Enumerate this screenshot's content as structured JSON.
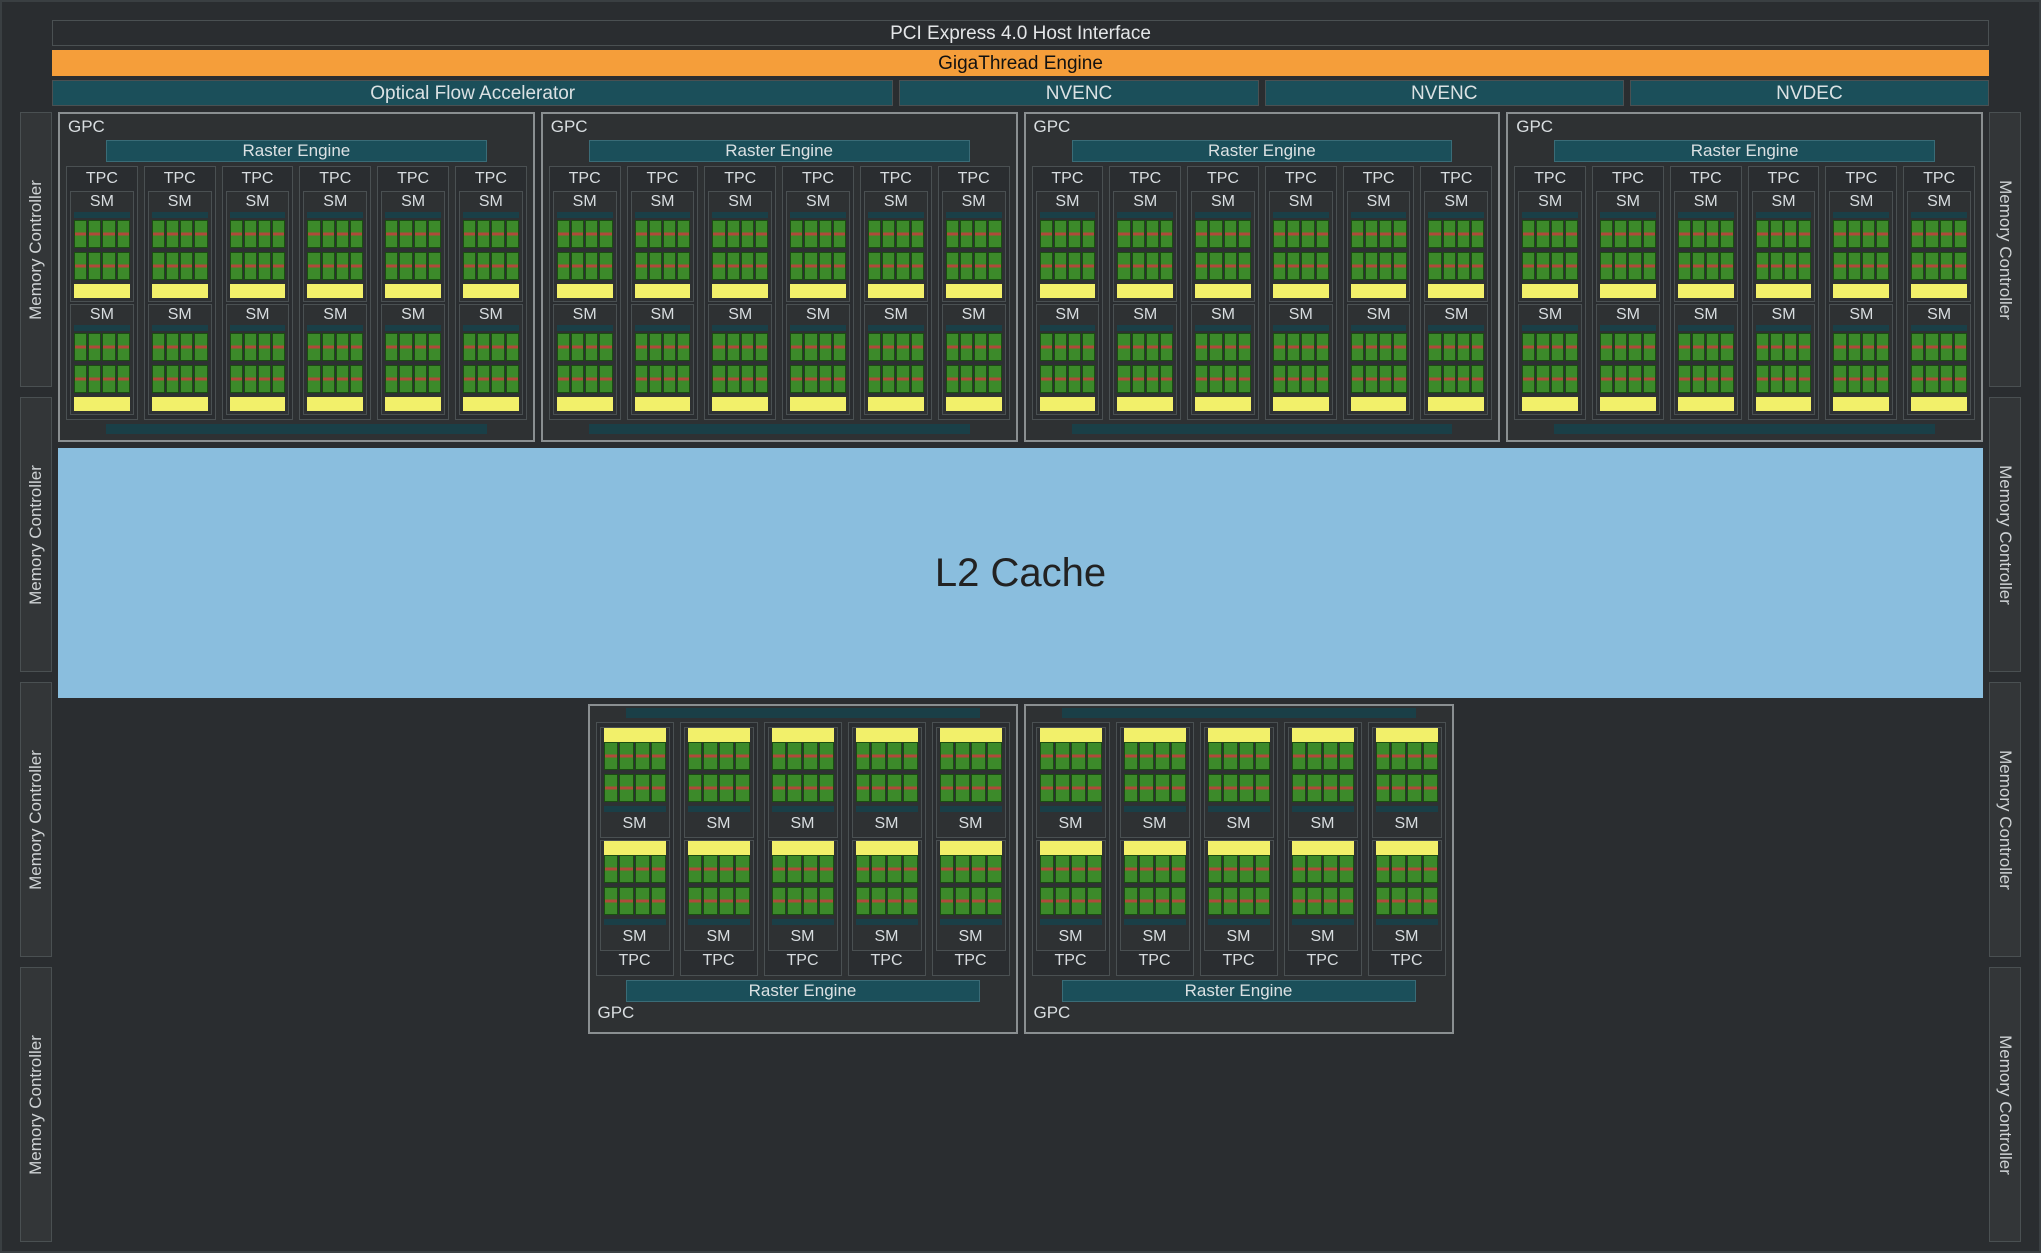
{
  "top": {
    "pci": "PCI Express 4.0 Host Interface",
    "giga": "GigaThread Engine",
    "ofa": "Optical Flow Accelerator",
    "nvenc": "NVENC",
    "nvdec": "NVDEC"
  },
  "labels": {
    "memctl": "Memory Controller",
    "gpc": "GPC",
    "raster": "Raster Engine",
    "tpc": "TPC",
    "sm": "SM",
    "l2": "L2 Cache"
  },
  "structure": {
    "mem_controllers_per_side": 4,
    "top_gpc_count": 4,
    "top_tpc_per_gpc": 6,
    "bottom_gpc_count": 2,
    "bottom_tpc_per_gpc": 5,
    "sm_per_tpc": 2,
    "green_cols_per_block": 4,
    "green_blocks_per_sm": 2
  }
}
